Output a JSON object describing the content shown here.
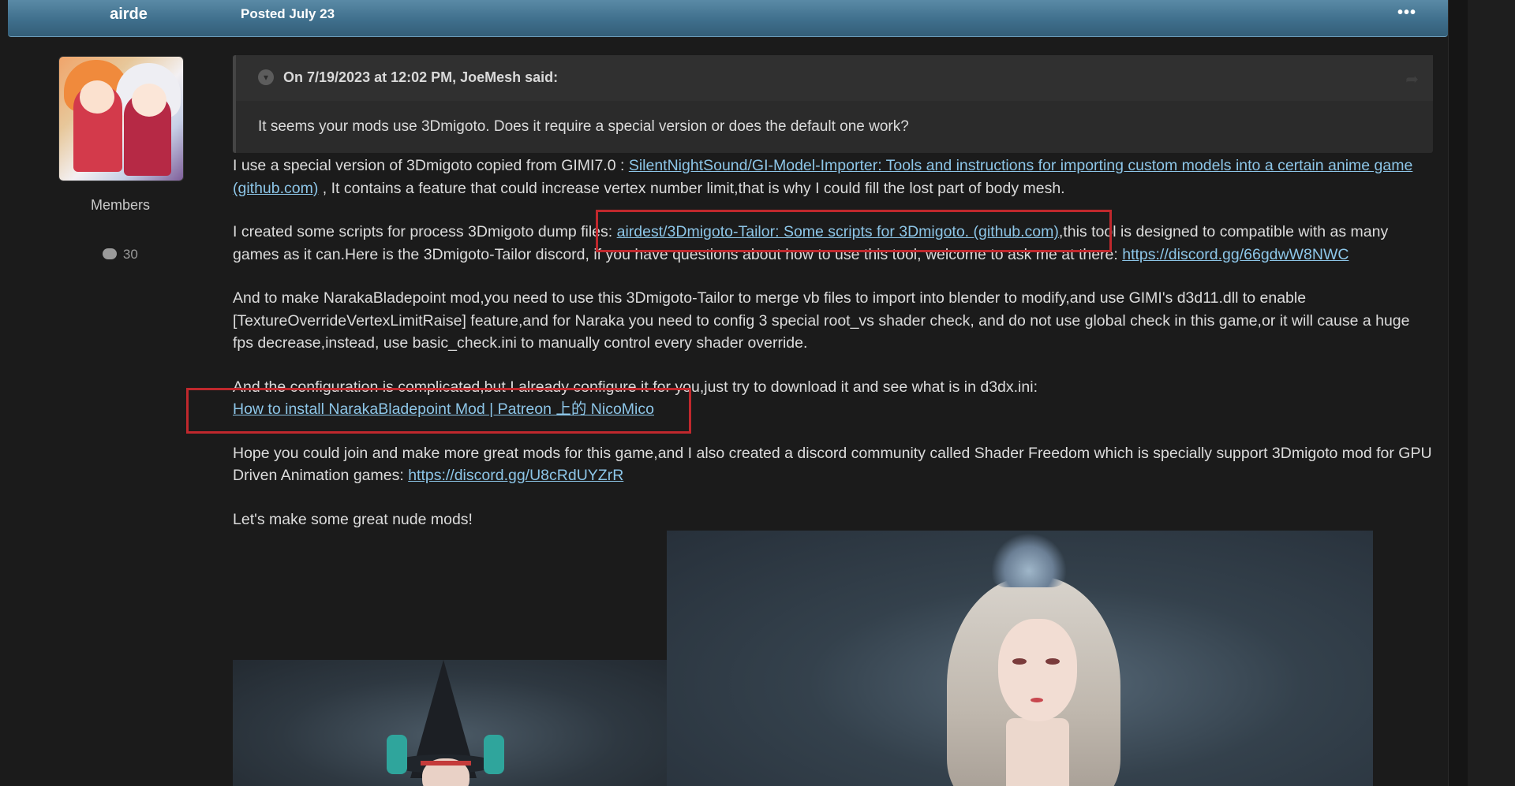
{
  "post": {
    "author": "airde",
    "date": "Posted July 23",
    "menu": "•••",
    "member_group": "Members",
    "post_count": "30"
  },
  "quote": {
    "cite": "On 7/19/2023 at 12:02 PM, JoeMesh said:",
    "body": "It seems your mods use 3Dmigoto. Does it require a special version or does the default one work?"
  },
  "content": {
    "p1_text_a": "I use a special version of 3Dmigoto copied from GIMI7.0 : ",
    "p1_link": "SilentNightSound/GI-Model-Importer: Tools and instructions for importing custom models into a certain anime game (github.com)",
    "p1_text_b": " , It contains a feature that could increase vertex number limit,that is why I could fill the lost part of body mesh.",
    "p2_text_a": "I created some scripts for process 3Dmigoto dump files: ",
    "p2_link": "airdest/3Dmigoto-Tailor: Some scripts for 3Dmigoto. (github.com)",
    "p2_text_b": ",this tool is designed to compatible with as many games as it can.Here is the 3Dmigoto-Tailor discord, if you have questions about how to use this tool, welcome to ask me at there: ",
    "p2_link2": "https://discord.gg/66gdwW8NWC",
    "p3_text": "And to make NarakaBladepoint mod,you need to use this 3Dmigoto-Tailor to merge vb files to import into blender to modify,and use GIMI's d3d11.dll to enable [TextureOverrideVertexLimitRaise] feature,and for Naraka you need to config 3 special root_vs shader check, and do not use global check in this game,or it will cause a huge fps decrease,instead, use basic_check.ini to manually control every shader override.",
    "p4_text": "And the configuration is complicated,but I already configure it for you,just try to download it and see what is in d3dx.ini:",
    "p4_link": "How to install NarakaBladepoint Mod | Patreon 上的 NicoMico",
    "p5_text": "Hope you could join and make more great mods for this game,and I also created a discord community called Shader Freedom which is specially support 3Dmigoto mod for GPU Driven Animation games: ",
    "p5_link": "https://discord.gg/U8cRdUYZrR",
    "p6_text": "Let's make some great nude mods!"
  },
  "colors": {
    "link": "#8dc6e8",
    "annotation_box": "#c0282d",
    "header": "#4a7c99"
  },
  "icons": {
    "quote_toggle": "chevron-down-icon",
    "quote_share": "share-icon",
    "post_count": "comment-bubble-icon"
  }
}
